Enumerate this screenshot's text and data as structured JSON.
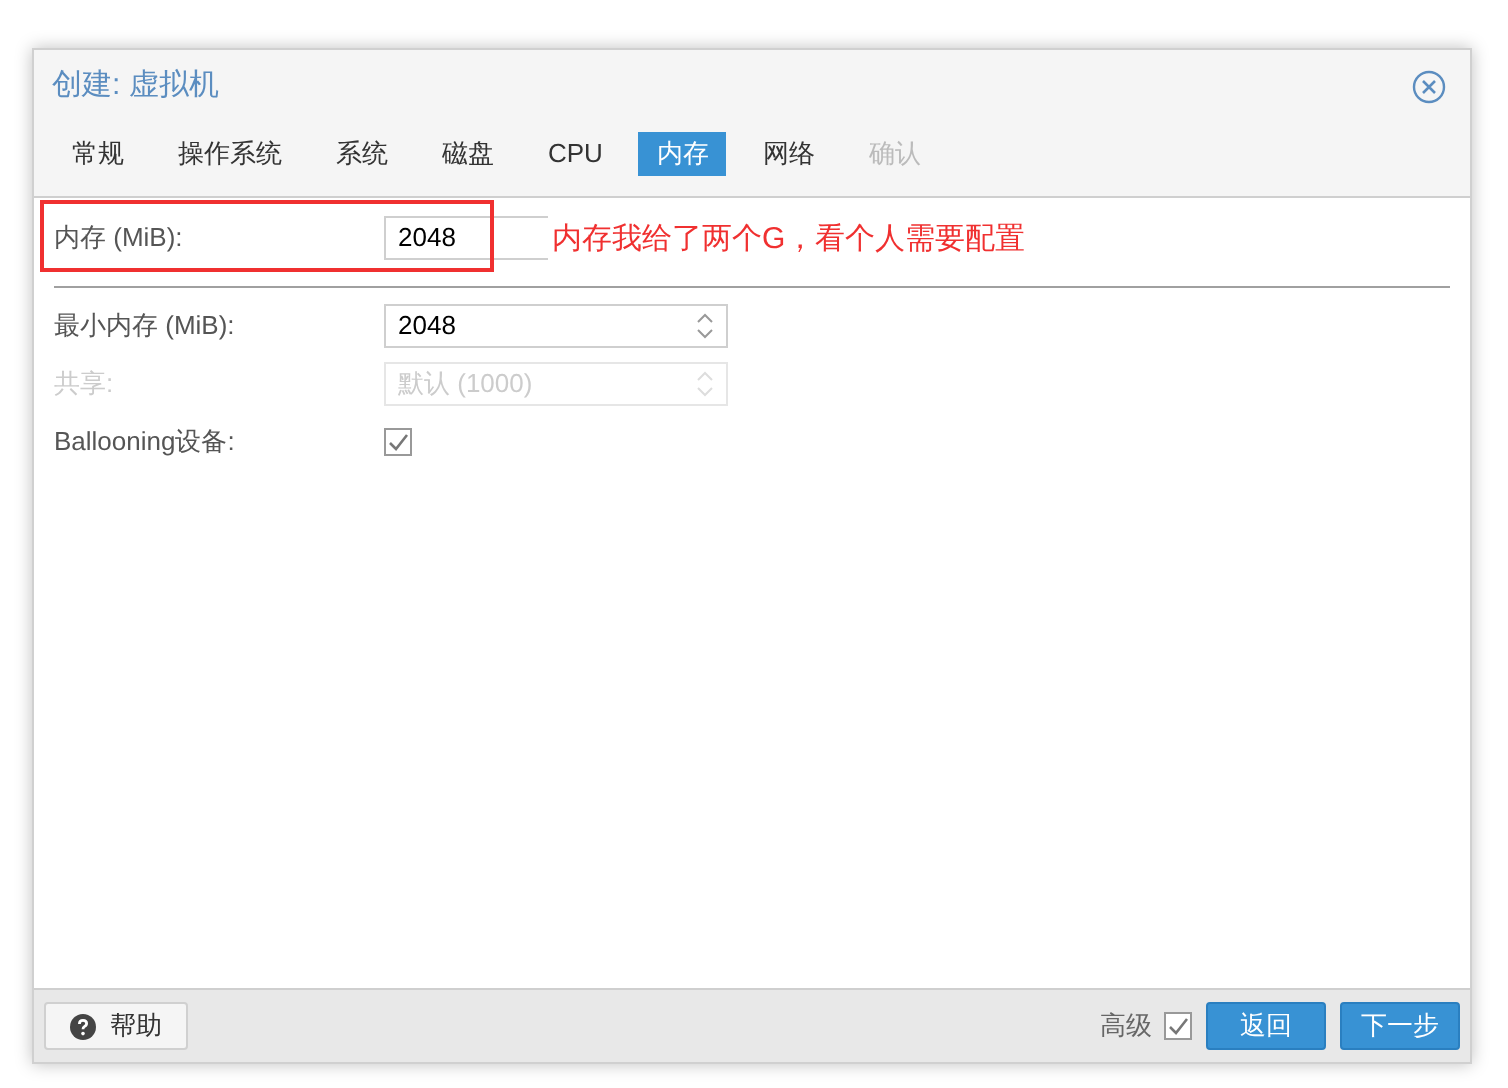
{
  "window": {
    "title": "创建: 虚拟机"
  },
  "tabs": [
    {
      "label": "常规",
      "selected": false,
      "disabled": false
    },
    {
      "label": "操作系统",
      "selected": false,
      "disabled": false
    },
    {
      "label": "系统",
      "selected": false,
      "disabled": false
    },
    {
      "label": "磁盘",
      "selected": false,
      "disabled": false
    },
    {
      "label": "CPU",
      "selected": false,
      "disabled": false
    },
    {
      "label": "内存",
      "selected": true,
      "disabled": false
    },
    {
      "label": "网络",
      "selected": false,
      "disabled": false
    },
    {
      "label": "确认",
      "selected": false,
      "disabled": true
    }
  ],
  "memory": {
    "label": "内存 (MiB):",
    "value": "2048"
  },
  "annotation": {
    "text": "内存我给了两个G，看个人需要配置"
  },
  "advanced_fields": [
    {
      "kind": "spinner",
      "label": "最小内存 (MiB):",
      "value": "2048",
      "disabled": false
    },
    {
      "kind": "spinner",
      "label": "共享:",
      "placeholder": "默认 (1000)",
      "disabled": true
    },
    {
      "kind": "checkbox",
      "label": "Ballooning设备:",
      "checked": true,
      "disabled": false
    }
  ],
  "footer": {
    "help": "帮助",
    "advanced_label": "高级",
    "advanced_checked": true,
    "back": "返回",
    "next": "下一步"
  }
}
